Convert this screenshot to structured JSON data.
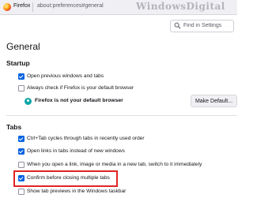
{
  "browser": {
    "app_name": "Firefox",
    "url": "about:preferences#general"
  },
  "watermark": "WindowsDigital",
  "search": {
    "placeholder": "Find in Settings"
  },
  "page": {
    "title": "General"
  },
  "startup": {
    "heading": "Startup",
    "items": [
      {
        "label": "Open previous windows and tabs",
        "checked": true
      },
      {
        "label": "Always check if Firefox is your default browser",
        "checked": false
      }
    ],
    "default_status": "Firefox is not your default browser",
    "make_default_label": "Make Default..."
  },
  "tabs": {
    "heading": "Tabs",
    "items": [
      {
        "label": "Ctrl+Tab cycles through tabs in recently used order",
        "checked": true
      },
      {
        "label": "Open links in tabs instead of new windows",
        "checked": true
      },
      {
        "label": "When you open a link, image or media in a new tab, switch to it immediately",
        "checked": false
      },
      {
        "label": "Confirm before closing multiple tabs",
        "checked": true
      },
      {
        "label": "Show tab previews in the Windows taskbar",
        "checked": false
      }
    ]
  },
  "colors": {
    "accent": "#0061e0",
    "highlight_box": "#e02424"
  },
  "icons": {
    "app": "firefox-logo-icon",
    "search": "search-icon",
    "status": "firefox-status-icon"
  }
}
